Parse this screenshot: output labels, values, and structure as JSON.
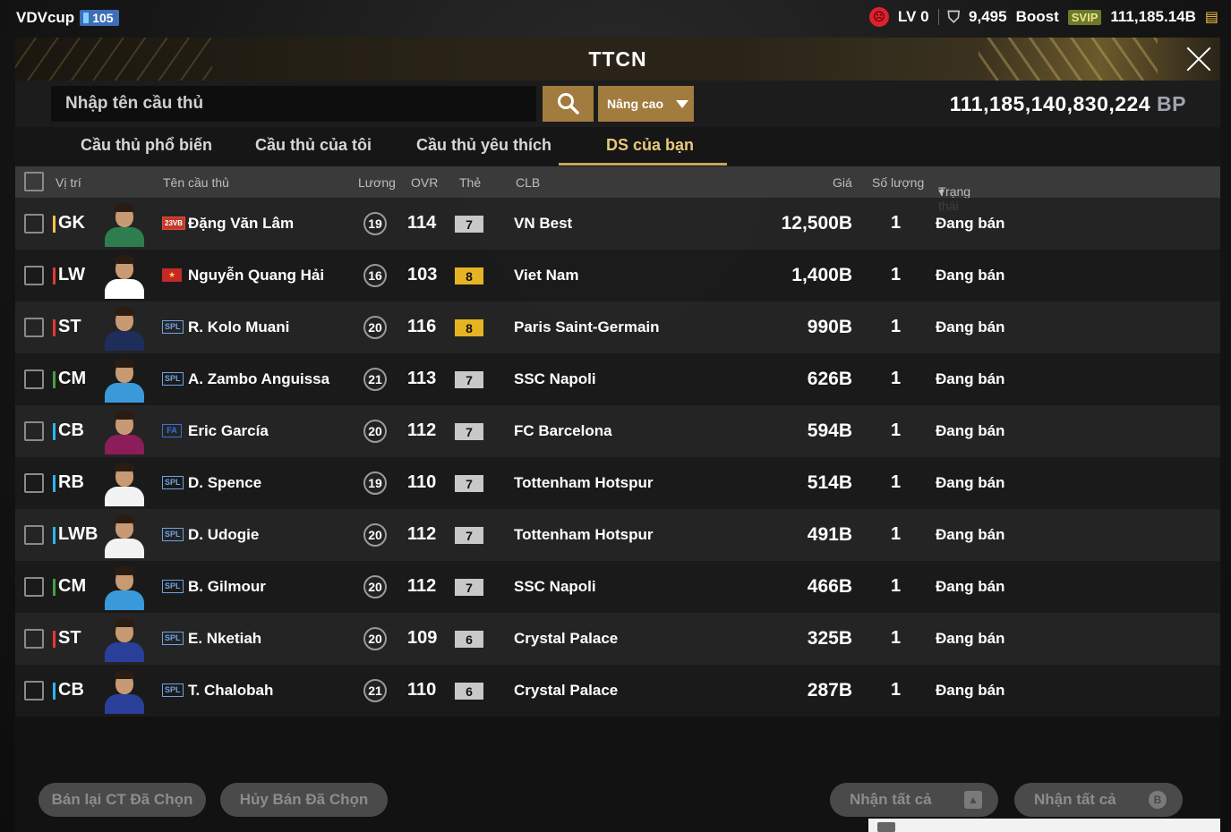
{
  "topbar": {
    "brand": "VDVcup",
    "level": "105",
    "lv": "LV 0",
    "shield_value": "9,495",
    "boost": "Boost",
    "svip": "SVIP",
    "coins": "111,185.14B"
  },
  "panel": {
    "title": "TTCN"
  },
  "search": {
    "placeholder": "Nhập tên cầu thủ",
    "advanced": "Nâng cao",
    "bp_value": "111,185,140,830,224",
    "bp_unit": "BP"
  },
  "tabs": [
    {
      "label": "Cầu thủ phổ biến",
      "active": false
    },
    {
      "label": "Cầu thủ của tôi",
      "active": false
    },
    {
      "label": "Cầu thủ yêu thích",
      "active": false
    },
    {
      "label": "DS của bạn",
      "active": true
    }
  ],
  "columns": {
    "position": "Vị trí",
    "name": "Tên cầu thủ",
    "salary": "Lương",
    "ovr": "OVR",
    "card": "Thẻ",
    "club": "CLB",
    "price": "Giá",
    "qty": "Số lượng",
    "status": "Trạng thái"
  },
  "rows": [
    {
      "pos": "GK",
      "pos_color": "#f5c542",
      "season": "23VB",
      "season_color": "#e04a3a",
      "name": "Đặng Văn Lâm",
      "salary": "19",
      "ovr": "114",
      "card": "7",
      "card_color": "#c8c8c8",
      "club": "VN Best",
      "price": "12,500B",
      "qty": "1",
      "status": "Đang bán",
      "kit": "#2e7d4f"
    },
    {
      "pos": "LW",
      "pos_color": "#e53935",
      "season": "★",
      "season_color": "#e53935",
      "name": "Nguyễn Quang Hải",
      "salary": "16",
      "ovr": "103",
      "card": "8",
      "card_color": "#e6b422",
      "club": "Viet Nam",
      "price": "1,400B",
      "qty": "1",
      "status": "Đang bán",
      "kit": "#ffffff"
    },
    {
      "pos": "ST",
      "pos_color": "#e53935",
      "season": "SPL",
      "season_color": "#6fa3e0",
      "name": "R. Kolo Muani",
      "salary": "20",
      "ovr": "116",
      "card": "8",
      "card_color": "#e6b422",
      "club": "Paris Saint-Germain",
      "price": "990B",
      "qty": "1",
      "status": "Đang bán",
      "kit": "#1f2d5a"
    },
    {
      "pos": "CM",
      "pos_color": "#43a047",
      "season": "SPL",
      "season_color": "#6fa3e0",
      "name": "A. Zambo Anguissa",
      "salary": "21",
      "ovr": "113",
      "card": "7",
      "card_color": "#c8c8c8",
      "club": "SSC Napoli",
      "price": "626B",
      "qty": "1",
      "status": "Đang bán",
      "kit": "#3a9ad9"
    },
    {
      "pos": "CB",
      "pos_color": "#29b6f6",
      "season": "FA",
      "season_color": "#3c6fd8",
      "name": "Eric García",
      "salary": "20",
      "ovr": "112",
      "card": "7",
      "card_color": "#c8c8c8",
      "club": "FC Barcelona",
      "price": "594B",
      "qty": "1",
      "status": "Đang bán",
      "kit": "#8c1c5a"
    },
    {
      "pos": "RB",
      "pos_color": "#29b6f6",
      "season": "SPL",
      "season_color": "#6fa3e0",
      "name": "D. Spence",
      "salary": "19",
      "ovr": "110",
      "card": "7",
      "card_color": "#c8c8c8",
      "club": "Tottenham Hotspur",
      "price": "514B",
      "qty": "1",
      "status": "Đang bán",
      "kit": "#f2f2f2"
    },
    {
      "pos": "LWB",
      "pos_color": "#29b6f6",
      "season": "SPL",
      "season_color": "#6fa3e0",
      "name": "D. Udogie",
      "salary": "20",
      "ovr": "112",
      "card": "7",
      "card_color": "#c8c8c8",
      "club": "Tottenham Hotspur",
      "price": "491B",
      "qty": "1",
      "status": "Đang bán",
      "kit": "#f2f2f2"
    },
    {
      "pos": "CM",
      "pos_color": "#43a047",
      "season": "SPL",
      "season_color": "#6fa3e0",
      "name": "B. Gilmour",
      "salary": "20",
      "ovr": "112",
      "card": "7",
      "card_color": "#c8c8c8",
      "club": "SSC Napoli",
      "price": "466B",
      "qty": "1",
      "status": "Đang bán",
      "kit": "#3a9ad9"
    },
    {
      "pos": "ST",
      "pos_color": "#e53935",
      "season": "SPL",
      "season_color": "#6fa3e0",
      "name": "E. Nketiah",
      "salary": "20",
      "ovr": "109",
      "card": "6",
      "card_color": "#c8c8c8",
      "club": "Crystal Palace",
      "price": "325B",
      "qty": "1",
      "status": "Đang bán",
      "kit": "#2a3f9a"
    },
    {
      "pos": "CB",
      "pos_color": "#29b6f6",
      "season": "SPL",
      "season_color": "#6fa3e0",
      "name": "T. Chalobah",
      "salary": "21",
      "ovr": "110",
      "card": "6",
      "card_color": "#c8c8c8",
      "club": "Crystal Palace",
      "price": "287B",
      "qty": "1",
      "status": "Đang bán",
      "kit": "#2a3f9a"
    }
  ],
  "buttons": {
    "resell": "Bán lại CT Đã Chọn",
    "cancel_sell": "Hủy Bán Đã Chọn",
    "claim_all_1": "Nhận tất cả",
    "claim_all_2": "Nhận tất cả"
  }
}
